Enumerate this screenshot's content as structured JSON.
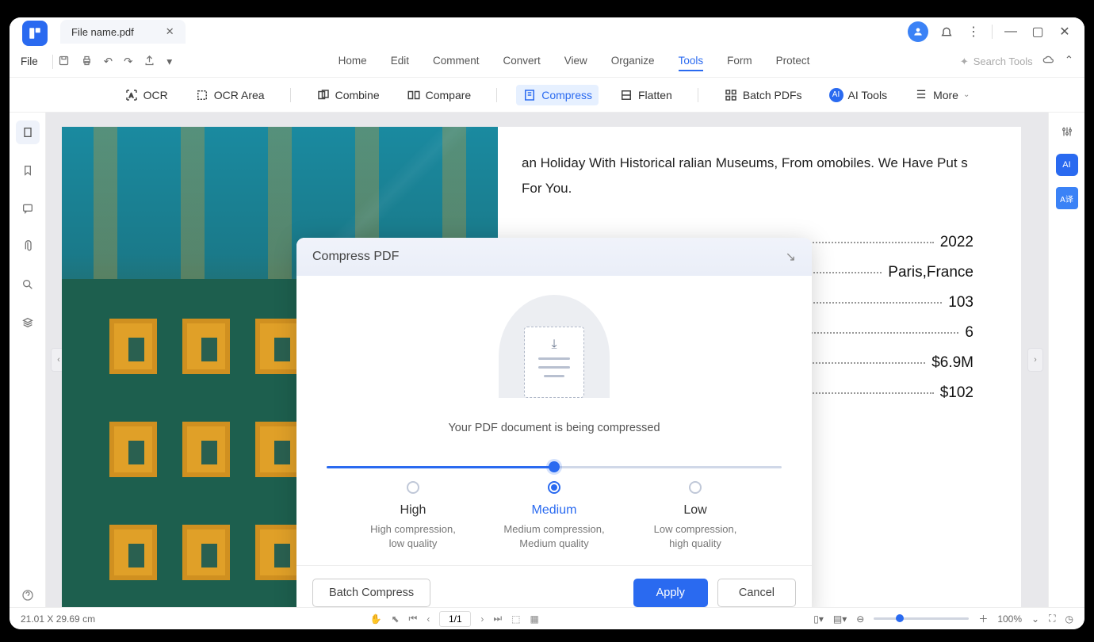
{
  "titlebar": {
    "tab_name": "File name.pdf"
  },
  "menubar": {
    "file": "File",
    "items": [
      "Home",
      "Edit",
      "Comment",
      "Convert",
      "View",
      "Organize",
      "Tools",
      "Form",
      "Protect"
    ],
    "active_index": 6,
    "search_placeholder": "Search Tools"
  },
  "ribbon": {
    "ocr": "OCR",
    "ocr_area": "OCR Area",
    "combine": "Combine",
    "compare": "Compare",
    "compress": "Compress",
    "flatten": "Flatten",
    "batch": "Batch PDFs",
    "ai": "AI Tools",
    "more": "More"
  },
  "document": {
    "text": "an Holiday With Historical ralian Museums, From omobiles. We Have Put s For You.",
    "rows": [
      {
        "label": "",
        "value": "2022"
      },
      {
        "label": "",
        "value": "Paris,France"
      },
      {
        "label": "",
        "value": "103"
      },
      {
        "label": "",
        "value": "6"
      },
      {
        "label": "",
        "value": "$6.9M"
      },
      {
        "label": "",
        "value": "$102"
      }
    ]
  },
  "modal": {
    "title": "Compress PDF",
    "progress_text": "Your PDF document is being compressed",
    "options": [
      {
        "title": "High",
        "desc1": "High compression,",
        "desc2": "low quality"
      },
      {
        "title": "Medium",
        "desc1": "Medium compression,",
        "desc2": "Medium quality"
      },
      {
        "title": "Low",
        "desc1": "Low compression,",
        "desc2": "high quality"
      }
    ],
    "selected_index": 1,
    "batch_btn": "Batch Compress",
    "apply_btn": "Apply",
    "cancel_btn": "Cancel"
  },
  "statusbar": {
    "dimensions": "21.01 X 29.69 cm",
    "page": "1/1",
    "zoom": "100%"
  }
}
